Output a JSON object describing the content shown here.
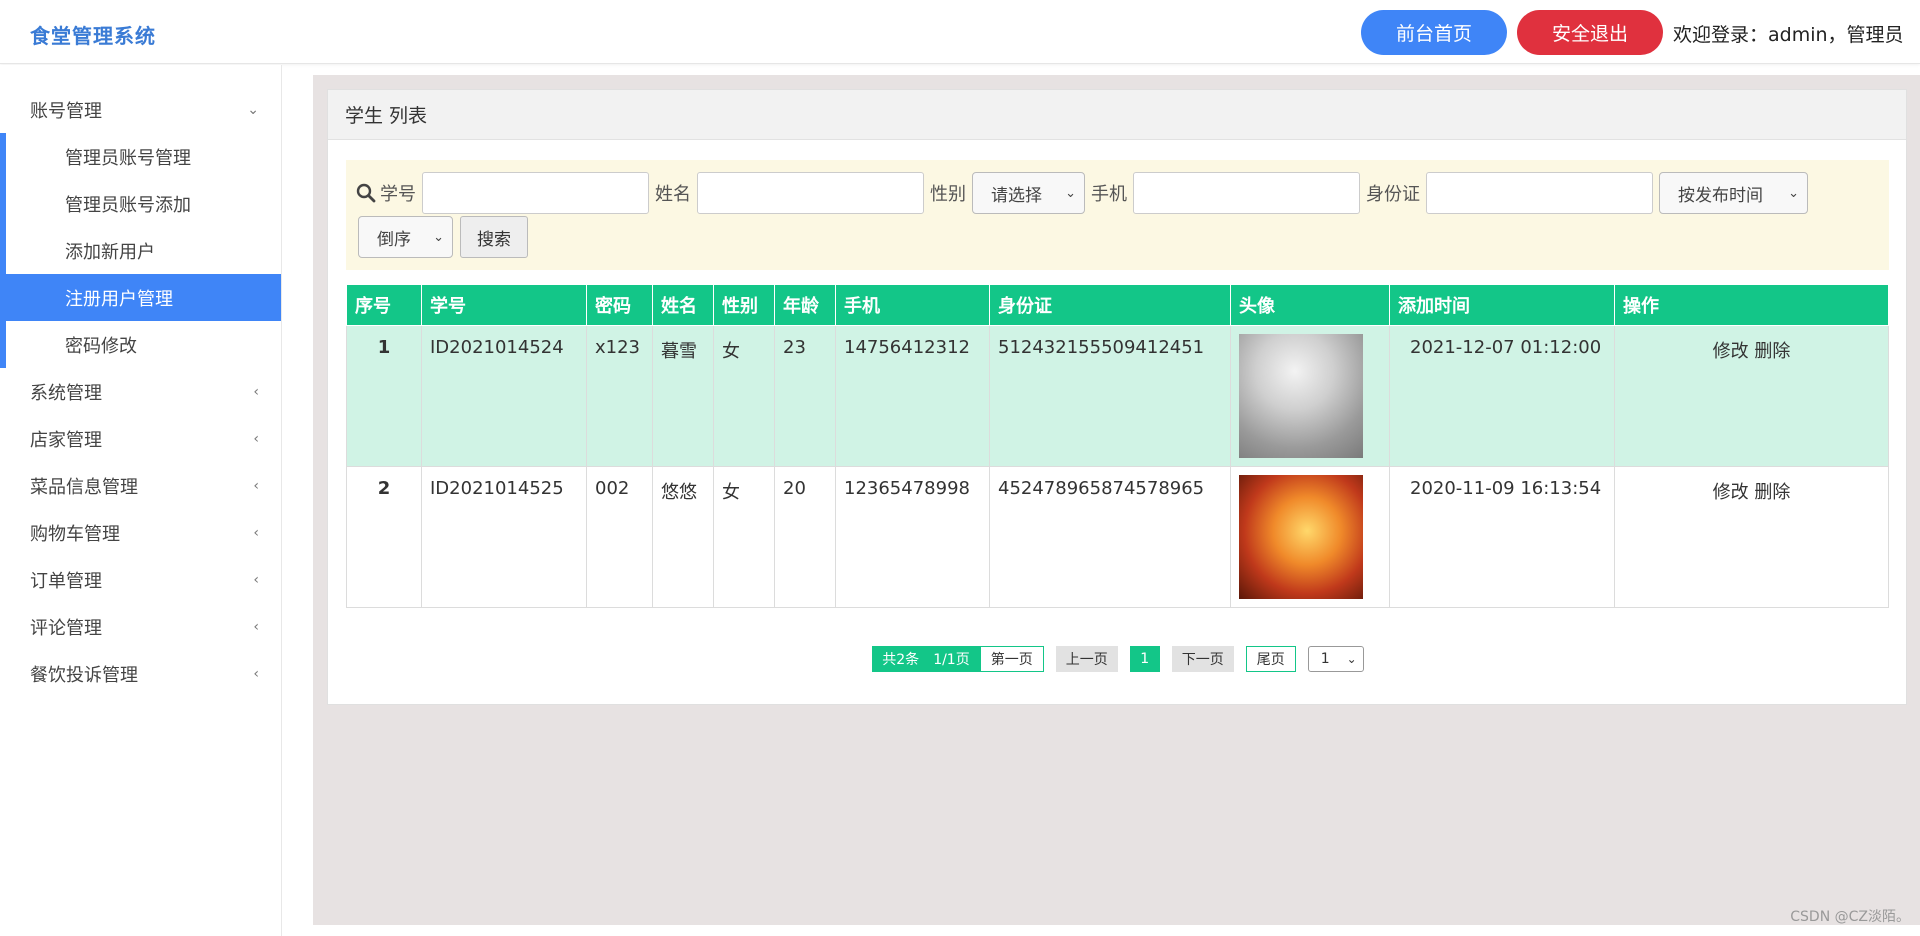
{
  "header": {
    "brand": "食堂管理系统",
    "home_button": "前台首页",
    "logout_button": "安全退出",
    "welcome": "欢迎登录：admin，管理员"
  },
  "sidebar": {
    "groups": [
      {
        "label": "账号管理",
        "expanded": true,
        "icon": "chevron-down-icon"
      },
      {
        "label": "系统管理",
        "icon": "chevron-left-icon"
      },
      {
        "label": "店家管理",
        "icon": "chevron-left-icon"
      },
      {
        "label": "菜品信息管理",
        "icon": "chevron-left-icon"
      },
      {
        "label": "购物车管理",
        "icon": "chevron-left-icon"
      },
      {
        "label": "订单管理",
        "icon": "chevron-left-icon"
      },
      {
        "label": "评论管理",
        "icon": "chevron-left-icon"
      },
      {
        "label": "餐饮投诉管理",
        "icon": "chevron-left-icon"
      }
    ],
    "sub_items": [
      {
        "label": "管理员账号管理"
      },
      {
        "label": "管理员账号添加"
      },
      {
        "label": "添加新用户"
      },
      {
        "label": "注册用户管理",
        "active": true
      },
      {
        "label": "密码修改"
      }
    ]
  },
  "panel": {
    "title": "学生 列表"
  },
  "search": {
    "icon": "search-icon",
    "student_id_label": "学号",
    "student_id_value": "",
    "name_label": "姓名",
    "name_value": "",
    "gender_label": "性别",
    "gender_selected": "请选择",
    "phone_label": "手机",
    "phone_value": "",
    "idcard_label": "身份证",
    "idcard_value": "",
    "sort_field_selected": "按发布时间",
    "sort_order_selected": "倒序",
    "search_button": "搜索"
  },
  "table": {
    "headers": [
      "序号",
      "学号",
      "密码",
      "姓名",
      "性别",
      "年龄",
      "手机",
      "身份证",
      "头像",
      "添加时间",
      "操作"
    ],
    "rows": [
      {
        "seq": "1",
        "student_id": "ID2021014524",
        "password": "x123",
        "name": "暮雪",
        "gender": "女",
        "age": "23",
        "phone": "14756412312",
        "idcard": "512432155509412451",
        "avatar": "avatar-image",
        "added_time": "2021-12-07 01:12:00",
        "edit": "修改",
        "delete": "删除"
      },
      {
        "seq": "2",
        "student_id": "ID2021014525",
        "password": "002",
        "name": "悠悠",
        "gender": "女",
        "age": "20",
        "phone": "12365478998",
        "idcard": "452478965874578965",
        "avatar": "avatar-image",
        "added_time": "2020-11-09 16:13:54",
        "edit": "修改",
        "delete": "删除"
      }
    ]
  },
  "pagination": {
    "total": "共2条",
    "page_info": "1/1页",
    "first": "第一页",
    "prev": "上一页",
    "current": "1",
    "next": "下一页",
    "last": "尾页",
    "page_select": "1"
  },
  "watermark": "CSDN @CZ淡陌。",
  "colors": {
    "primary": "#3f85f7",
    "danger": "#e0313e",
    "table_header": "#13c688",
    "highlight_row": "#d0f3e5",
    "search_bg": "#fcf8e3"
  }
}
